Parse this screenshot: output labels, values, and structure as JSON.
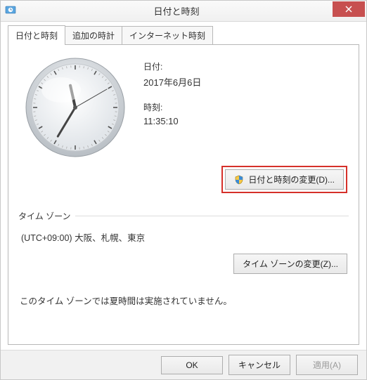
{
  "window": {
    "title": "日付と時刻"
  },
  "tabs": {
    "items": [
      {
        "label": "日付と時刻"
      },
      {
        "label": "追加の時計"
      },
      {
        "label": "インターネット時刻"
      }
    ]
  },
  "datetime": {
    "date_label": "日付:",
    "date_value": "2017年6月6日",
    "time_label": "時刻:",
    "time_value": "11:35:10",
    "change_label": "日付と時刻の変更(D)..."
  },
  "clock": {
    "hour": 11,
    "minute": 35,
    "second": 10
  },
  "timezone": {
    "section_label": "タイム ゾーン",
    "value": "(UTC+09:00) 大阪、札幌、東京",
    "change_label": "タイム ゾーンの変更(Z)..."
  },
  "dst": {
    "note": "このタイム ゾーンでは夏時間は実施されていません。"
  },
  "footer": {
    "ok": "OK",
    "cancel": "キャンセル",
    "apply": "適用(A)"
  }
}
